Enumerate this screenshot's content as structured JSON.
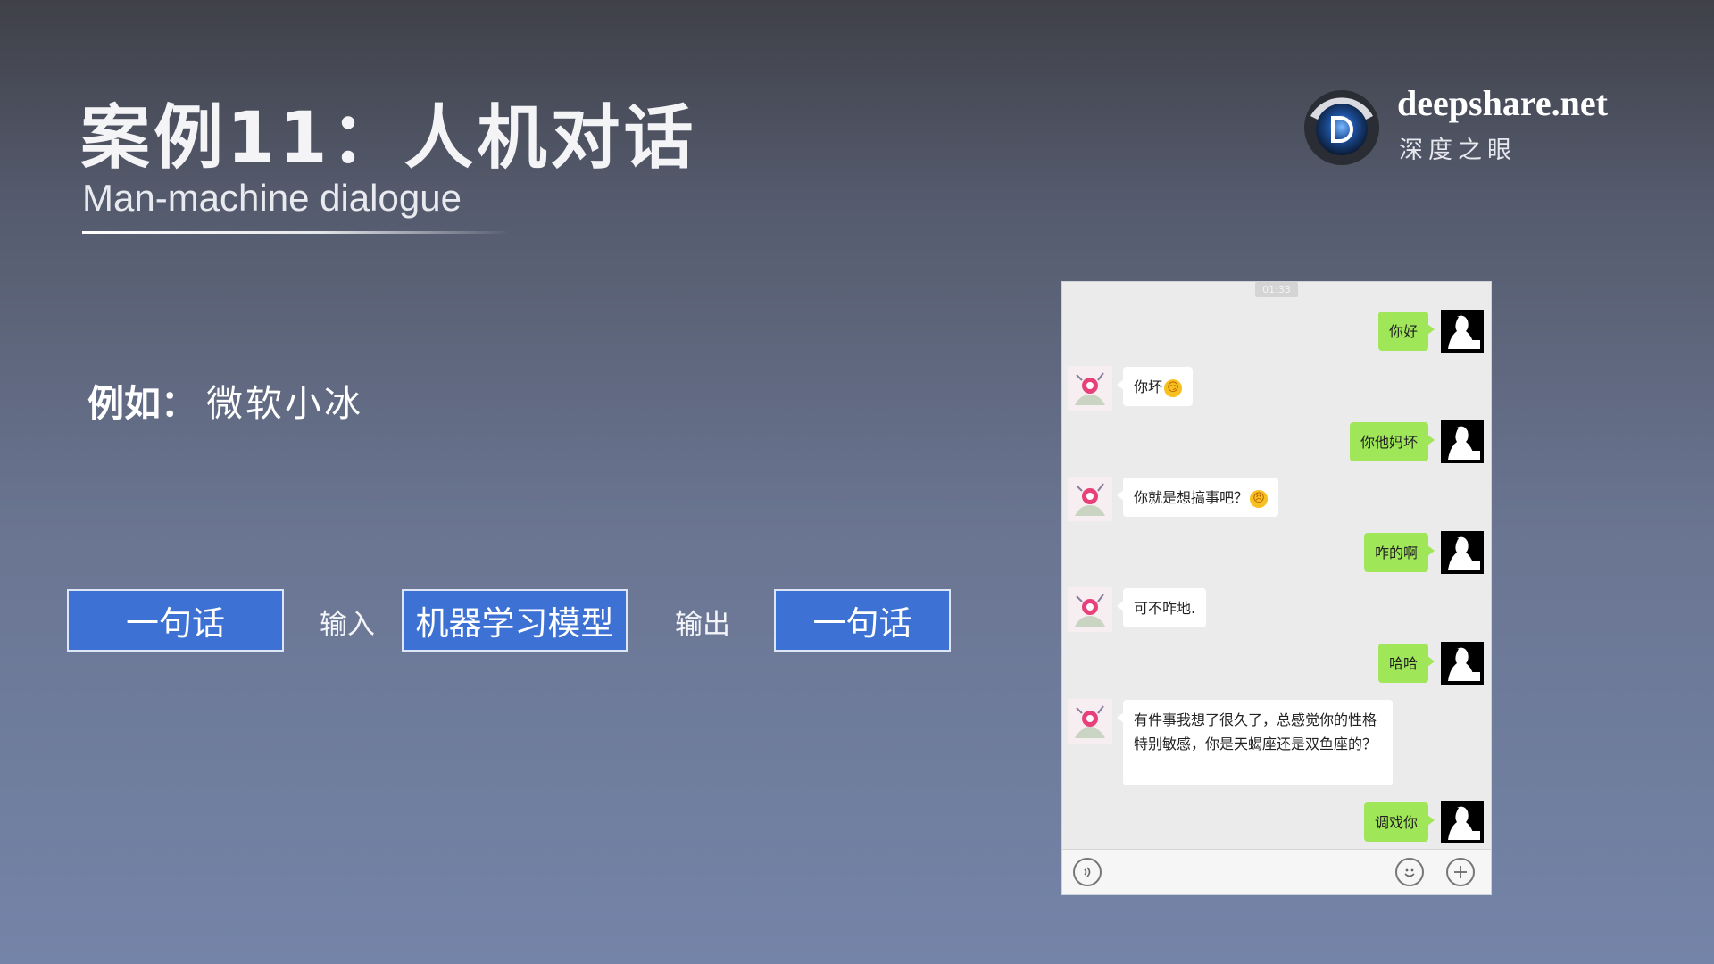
{
  "header": {
    "title": "案例11：人机对话",
    "subtitle": "Man-machine dialogue"
  },
  "logo": {
    "name": "deepshare.net",
    "tagline": "深度之眼",
    "icon": "eye-logo-icon"
  },
  "example": {
    "prefix": "例如：",
    "value": "微软小冰"
  },
  "flow": {
    "input_box": "一句话",
    "input_label": "输入",
    "model_box": "机器学习模型",
    "output_label": "输出",
    "output_box": "一句话"
  },
  "chat": {
    "time": "01:33",
    "messages": [
      {
        "from": "me",
        "text": "你好"
      },
      {
        "from": "bot",
        "text": "你坏",
        "emoji": "😏"
      },
      {
        "from": "me",
        "text": "你他妈坏"
      },
      {
        "from": "bot",
        "text": "你就是想搞事吧？",
        "emoji": "😣"
      },
      {
        "from": "me",
        "text": "咋的啊"
      },
      {
        "from": "bot",
        "text": "可不咋地."
      },
      {
        "from": "me",
        "text": "哈哈"
      },
      {
        "from": "bot",
        "text": "有件事我想了很久了，总感觉你的性格特别敏感，你是天蝎座还是双鱼座的？"
      },
      {
        "from": "me",
        "text": "调戏你"
      }
    ],
    "input_icons": [
      "voice-icon",
      "emoji-icon",
      "plus-icon"
    ]
  },
  "colors": {
    "accent_box": "#3d72d4",
    "my_bubble": "#9fe658",
    "bot_bubble": "#ffffff"
  }
}
